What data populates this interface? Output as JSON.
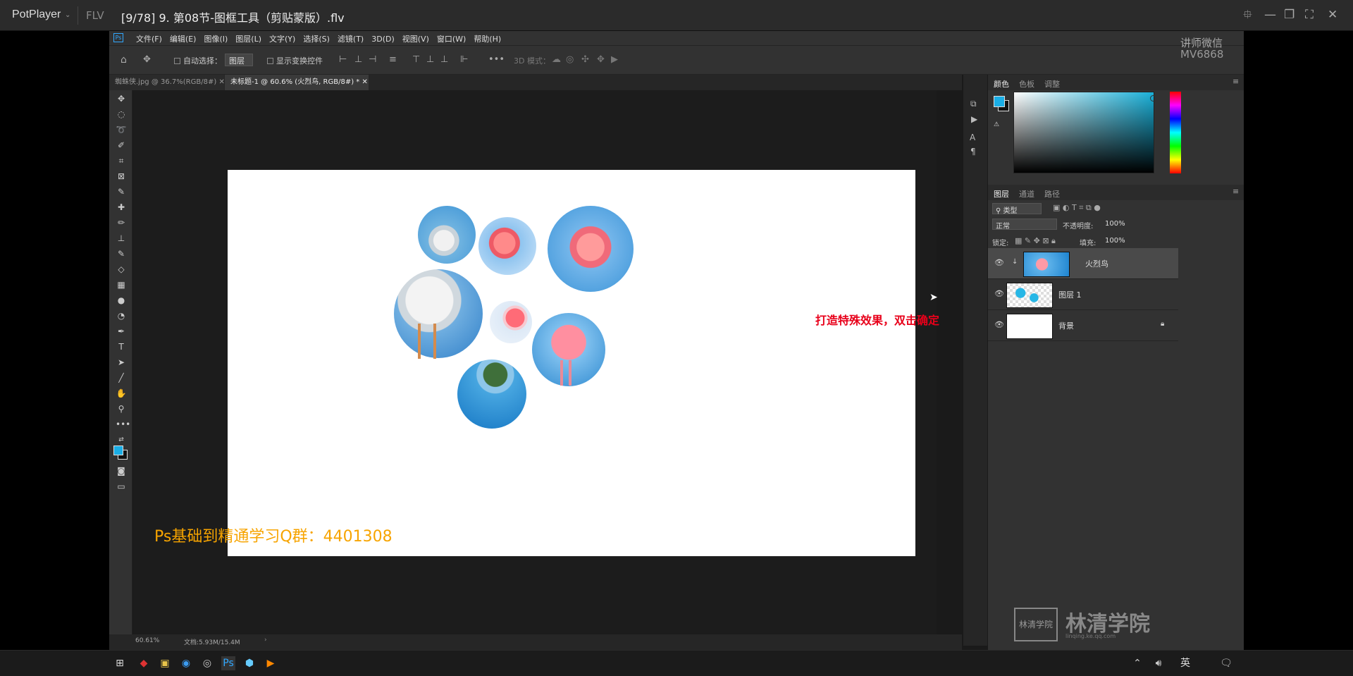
{
  "player": {
    "name": "PotPlayer",
    "format": "FLV",
    "title": "[9/78] 9. 第08节-图框工具（剪贴蒙版）.flv",
    "controls": [
      "pin-icon",
      "minimize-icon",
      "restore-icon",
      "fullscreen-icon",
      "close-icon"
    ]
  },
  "ps": {
    "menus": [
      "文件(F)",
      "编辑(E)",
      "图像(I)",
      "图层(L)",
      "文字(Y)",
      "选择(S)",
      "滤镜(T)",
      "3D(D)",
      "视图(V)",
      "窗口(W)",
      "帮助(H)"
    ],
    "options": {
      "auto_select_label": "自动选择：",
      "auto_select_value": "图层",
      "show_transform_label": "显示变换控件",
      "mode3d_label": "3D 模式："
    },
    "tabs": [
      {
        "label": "蜘蛛侠.jpg @ 36.7%(RGB/8#)",
        "active": false
      },
      {
        "label": "未标题-1 @ 60.6% (火烈鸟, RGB/8#) *",
        "active": true
      }
    ],
    "status": {
      "zoom": "60.61%",
      "doc": "文档:5.93M/15.4M"
    },
    "annotation": "打造特殊效果，双击确定",
    "qq_group": "Ps基础到精通学习Q群：4401308",
    "color_panel": {
      "tabs": [
        "颜色",
        "色板",
        "调整"
      ],
      "foreground": "#1aaee6",
      "background": "#111111"
    },
    "layers_panel": {
      "tabs": [
        "图层",
        "通道",
        "路径"
      ],
      "filter_label": "类型",
      "blend_mode": "正常",
      "opacity_label": "不透明度:",
      "opacity_value": "100%",
      "lock_label": "锁定:",
      "fill_label": "填充:",
      "fill_value": "100%",
      "layers": [
        {
          "name": "火烈鸟",
          "selected": true,
          "thumb": "photo"
        },
        {
          "name": "图层 1",
          "selected": false,
          "thumb": "circles"
        },
        {
          "name": "背景",
          "selected": false,
          "thumb": "white",
          "locked": true
        }
      ]
    },
    "watermark": {
      "line1": "讲师微信",
      "line2": "MV6868",
      "brand": "林清学院",
      "brand_logo": "林清学院",
      "brand_sub": "linqing.ke.qq.com"
    }
  },
  "taskbar": {
    "lang": "英"
  }
}
